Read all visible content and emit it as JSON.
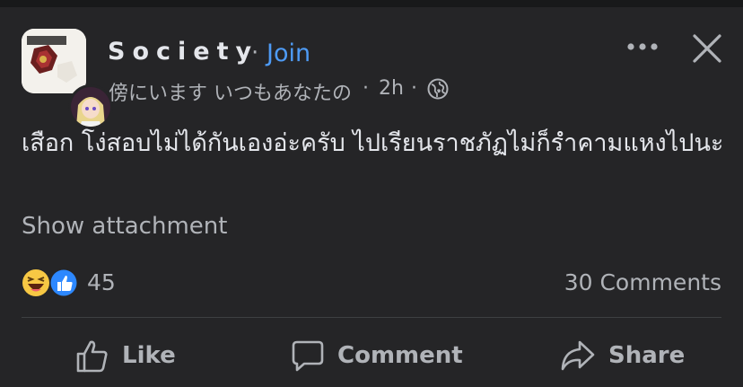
{
  "post": {
    "group_name": "Society",
    "separator": "·",
    "join_label": "Join",
    "author": "傍にいます いつもあなたの",
    "time": "2h",
    "audience_icon": "globe-icon",
    "text": "เสือก โง่สอบไม่ได้กันเองอ่ะครับ ไปเรียนราชภัฏไม่ก็รำคามแหงไปนะ",
    "attachment_label": "Show attachment",
    "reaction_icons": [
      "haha-icon",
      "like-reaction-icon"
    ],
    "reaction_count": "45",
    "comments_label": "30 Comments"
  },
  "actions": {
    "like_label": "Like",
    "comment_label": "Comment",
    "share_label": "Share"
  },
  "colors": {
    "background": "#252527",
    "link_blue": "#4e9bf5",
    "muted": "#b0b3b8",
    "text": "#e4e6eb"
  }
}
